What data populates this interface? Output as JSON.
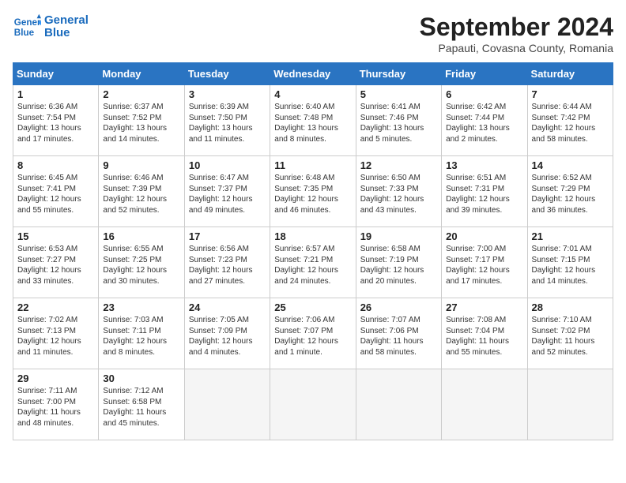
{
  "header": {
    "logo_line1": "General",
    "logo_line2": "Blue",
    "month": "September 2024",
    "location": "Papauti, Covasna County, Romania"
  },
  "weekdays": [
    "Sunday",
    "Monday",
    "Tuesday",
    "Wednesday",
    "Thursday",
    "Friday",
    "Saturday"
  ],
  "weeks": [
    [
      {
        "day": "1",
        "lines": [
          "Sunrise: 6:36 AM",
          "Sunset: 7:54 PM",
          "Daylight: 13 hours",
          "and 17 minutes."
        ]
      },
      {
        "day": "2",
        "lines": [
          "Sunrise: 6:37 AM",
          "Sunset: 7:52 PM",
          "Daylight: 13 hours",
          "and 14 minutes."
        ]
      },
      {
        "day": "3",
        "lines": [
          "Sunrise: 6:39 AM",
          "Sunset: 7:50 PM",
          "Daylight: 13 hours",
          "and 11 minutes."
        ]
      },
      {
        "day": "4",
        "lines": [
          "Sunrise: 6:40 AM",
          "Sunset: 7:48 PM",
          "Daylight: 13 hours",
          "and 8 minutes."
        ]
      },
      {
        "day": "5",
        "lines": [
          "Sunrise: 6:41 AM",
          "Sunset: 7:46 PM",
          "Daylight: 13 hours",
          "and 5 minutes."
        ]
      },
      {
        "day": "6",
        "lines": [
          "Sunrise: 6:42 AM",
          "Sunset: 7:44 PM",
          "Daylight: 13 hours",
          "and 2 minutes."
        ]
      },
      {
        "day": "7",
        "lines": [
          "Sunrise: 6:44 AM",
          "Sunset: 7:42 PM",
          "Daylight: 12 hours",
          "and 58 minutes."
        ]
      }
    ],
    [
      {
        "day": "8",
        "lines": [
          "Sunrise: 6:45 AM",
          "Sunset: 7:41 PM",
          "Daylight: 12 hours",
          "and 55 minutes."
        ]
      },
      {
        "day": "9",
        "lines": [
          "Sunrise: 6:46 AM",
          "Sunset: 7:39 PM",
          "Daylight: 12 hours",
          "and 52 minutes."
        ]
      },
      {
        "day": "10",
        "lines": [
          "Sunrise: 6:47 AM",
          "Sunset: 7:37 PM",
          "Daylight: 12 hours",
          "and 49 minutes."
        ]
      },
      {
        "day": "11",
        "lines": [
          "Sunrise: 6:48 AM",
          "Sunset: 7:35 PM",
          "Daylight: 12 hours",
          "and 46 minutes."
        ]
      },
      {
        "day": "12",
        "lines": [
          "Sunrise: 6:50 AM",
          "Sunset: 7:33 PM",
          "Daylight: 12 hours",
          "and 43 minutes."
        ]
      },
      {
        "day": "13",
        "lines": [
          "Sunrise: 6:51 AM",
          "Sunset: 7:31 PM",
          "Daylight: 12 hours",
          "and 39 minutes."
        ]
      },
      {
        "day": "14",
        "lines": [
          "Sunrise: 6:52 AM",
          "Sunset: 7:29 PM",
          "Daylight: 12 hours",
          "and 36 minutes."
        ]
      }
    ],
    [
      {
        "day": "15",
        "lines": [
          "Sunrise: 6:53 AM",
          "Sunset: 7:27 PM",
          "Daylight: 12 hours",
          "and 33 minutes."
        ]
      },
      {
        "day": "16",
        "lines": [
          "Sunrise: 6:55 AM",
          "Sunset: 7:25 PM",
          "Daylight: 12 hours",
          "and 30 minutes."
        ]
      },
      {
        "day": "17",
        "lines": [
          "Sunrise: 6:56 AM",
          "Sunset: 7:23 PM",
          "Daylight: 12 hours",
          "and 27 minutes."
        ]
      },
      {
        "day": "18",
        "lines": [
          "Sunrise: 6:57 AM",
          "Sunset: 7:21 PM",
          "Daylight: 12 hours",
          "and 24 minutes."
        ]
      },
      {
        "day": "19",
        "lines": [
          "Sunrise: 6:58 AM",
          "Sunset: 7:19 PM",
          "Daylight: 12 hours",
          "and 20 minutes."
        ]
      },
      {
        "day": "20",
        "lines": [
          "Sunrise: 7:00 AM",
          "Sunset: 7:17 PM",
          "Daylight: 12 hours",
          "and 17 minutes."
        ]
      },
      {
        "day": "21",
        "lines": [
          "Sunrise: 7:01 AM",
          "Sunset: 7:15 PM",
          "Daylight: 12 hours",
          "and 14 minutes."
        ]
      }
    ],
    [
      {
        "day": "22",
        "lines": [
          "Sunrise: 7:02 AM",
          "Sunset: 7:13 PM",
          "Daylight: 12 hours",
          "and 11 minutes."
        ]
      },
      {
        "day": "23",
        "lines": [
          "Sunrise: 7:03 AM",
          "Sunset: 7:11 PM",
          "Daylight: 12 hours",
          "and 8 minutes."
        ]
      },
      {
        "day": "24",
        "lines": [
          "Sunrise: 7:05 AM",
          "Sunset: 7:09 PM",
          "Daylight: 12 hours",
          "and 4 minutes."
        ]
      },
      {
        "day": "25",
        "lines": [
          "Sunrise: 7:06 AM",
          "Sunset: 7:07 PM",
          "Daylight: 12 hours",
          "and 1 minute."
        ]
      },
      {
        "day": "26",
        "lines": [
          "Sunrise: 7:07 AM",
          "Sunset: 7:06 PM",
          "Daylight: 11 hours",
          "and 58 minutes."
        ]
      },
      {
        "day": "27",
        "lines": [
          "Sunrise: 7:08 AM",
          "Sunset: 7:04 PM",
          "Daylight: 11 hours",
          "and 55 minutes."
        ]
      },
      {
        "day": "28",
        "lines": [
          "Sunrise: 7:10 AM",
          "Sunset: 7:02 PM",
          "Daylight: 11 hours",
          "and 52 minutes."
        ]
      }
    ],
    [
      {
        "day": "29",
        "lines": [
          "Sunrise: 7:11 AM",
          "Sunset: 7:00 PM",
          "Daylight: 11 hours",
          "and 48 minutes."
        ]
      },
      {
        "day": "30",
        "lines": [
          "Sunrise: 7:12 AM",
          "Sunset: 6:58 PM",
          "Daylight: 11 hours",
          "and 45 minutes."
        ]
      },
      {
        "day": "",
        "lines": []
      },
      {
        "day": "",
        "lines": []
      },
      {
        "day": "",
        "lines": []
      },
      {
        "day": "",
        "lines": []
      },
      {
        "day": "",
        "lines": []
      }
    ]
  ]
}
